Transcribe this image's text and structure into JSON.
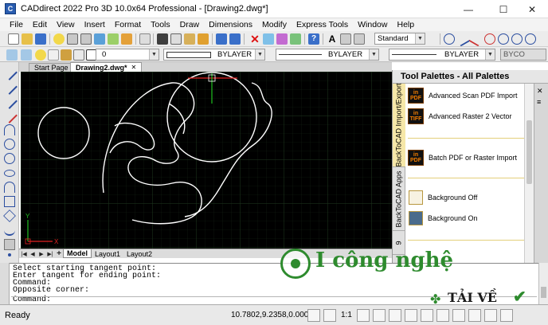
{
  "window": {
    "title": "CADdirect 2022 Pro 3D 10.0x64 Professional  - [Drawing2.dwg*]",
    "minimize_glyph": "—",
    "maximize_glyph": "☐",
    "close_glyph": "✕"
  },
  "menu": [
    "File",
    "Edit",
    "View",
    "Insert",
    "Format",
    "Tools",
    "Draw",
    "Dimensions",
    "Modify",
    "Express Tools",
    "Window",
    "Help"
  ],
  "toolbar": {
    "text_style": "Standard",
    "layer_value": "0",
    "color_value": "BYLAYER",
    "linetype_value": "BYLAYER",
    "lineweight_value": "BYLAYER",
    "plot_style_value": "BYCO"
  },
  "doc_tabs": [
    "Start Page",
    "Drawing2.dwg*"
  ],
  "layout_tabs": [
    "Model",
    "Layout1",
    "Layout2"
  ],
  "layout_add": "+",
  "palette": {
    "title": "Tool Palettes - All Palettes",
    "side_tabs": [
      "BackToCAD Import/Export",
      "BackToCAD Apps",
      "9"
    ],
    "items": [
      {
        "label": "Advanced Scan PDF Import",
        "icon_top": "in",
        "icon_bottom": "PDF"
      },
      {
        "label": "Advanced Raster 2 Vector",
        "icon_top": "in",
        "icon_bottom": "TIFF"
      },
      {
        "label": "Batch PDF or Raster Import",
        "icon_top": "in",
        "icon_bottom": "PDF"
      },
      {
        "label": "Background Off",
        "icon_top": "",
        "icon_bottom": ""
      },
      {
        "label": "Background On",
        "icon_top": "",
        "icon_bottom": ""
      }
    ]
  },
  "command": {
    "history": [
      "Select starting tangent point:",
      "Enter tangent for ending point:",
      "Command:",
      "Opposite corner:"
    ],
    "prompt": "Command:"
  },
  "status": {
    "ready": "Ready",
    "coords": "10.7802,9.2358,0.0000",
    "scale": "1:1"
  },
  "watermark": {
    "brand": "I công nghệ",
    "download": "TẢI VỀ"
  },
  "axis": {
    "x": "X",
    "y": "Y"
  },
  "colors": {
    "canvas_bg": "#000000",
    "curve": "#ffffff",
    "crosshair_red": "#e02020",
    "crosshair_green": "#20c020",
    "grid": "#1c2a1c",
    "watermark_green": "#2e8b2e"
  }
}
